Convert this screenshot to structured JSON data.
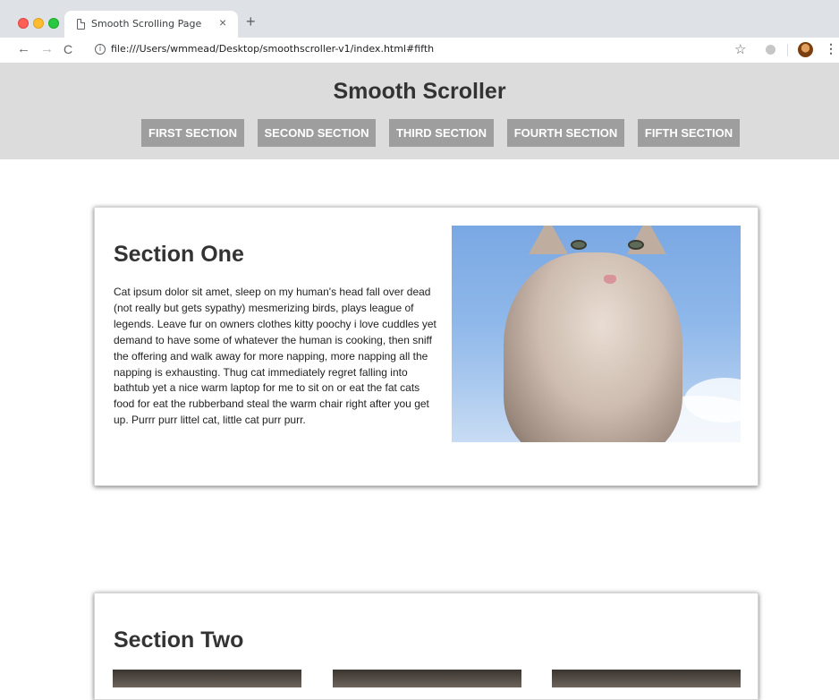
{
  "browser": {
    "tab_title": "Smooth Scrolling Page",
    "tab_close": "×",
    "new_tab": "+",
    "back": "←",
    "forward": "→",
    "reload": "C",
    "info": "i",
    "url": "file:///Users/wmmead/Desktop/smoothscroller-v1/index.html#fifth",
    "star": "☆",
    "menu": "⋮"
  },
  "site": {
    "title": "Smooth Scroller",
    "nav": [
      {
        "label": "FIRST SECTION"
      },
      {
        "label": "SECOND SECTION"
      },
      {
        "label": "THIRD SECTION"
      },
      {
        "label": "FOURTH SECTION"
      },
      {
        "label": "FIFTH SECTION"
      }
    ]
  },
  "sections": [
    {
      "title": "Section One",
      "text": "Cat ipsum dolor sit amet, sleep on my human's head fall over dead (not really but gets sypathy) mesmerizing birds, plays league of legends. Leave fur on owners clothes kitty poochy i love cuddles yet demand to have some of whatever the human is cooking, then sniff the offering and walk away for more napping, more napping all the napping is exhausting. Thug cat immediately regret falling into bathtub yet a nice warm laptop for me to sit on or eat the fat cats food for eat the rubberband steal the warm chair right after you get up. Purrr purr littel cat, little cat purr purr."
    },
    {
      "title": "Section Two"
    }
  ]
}
